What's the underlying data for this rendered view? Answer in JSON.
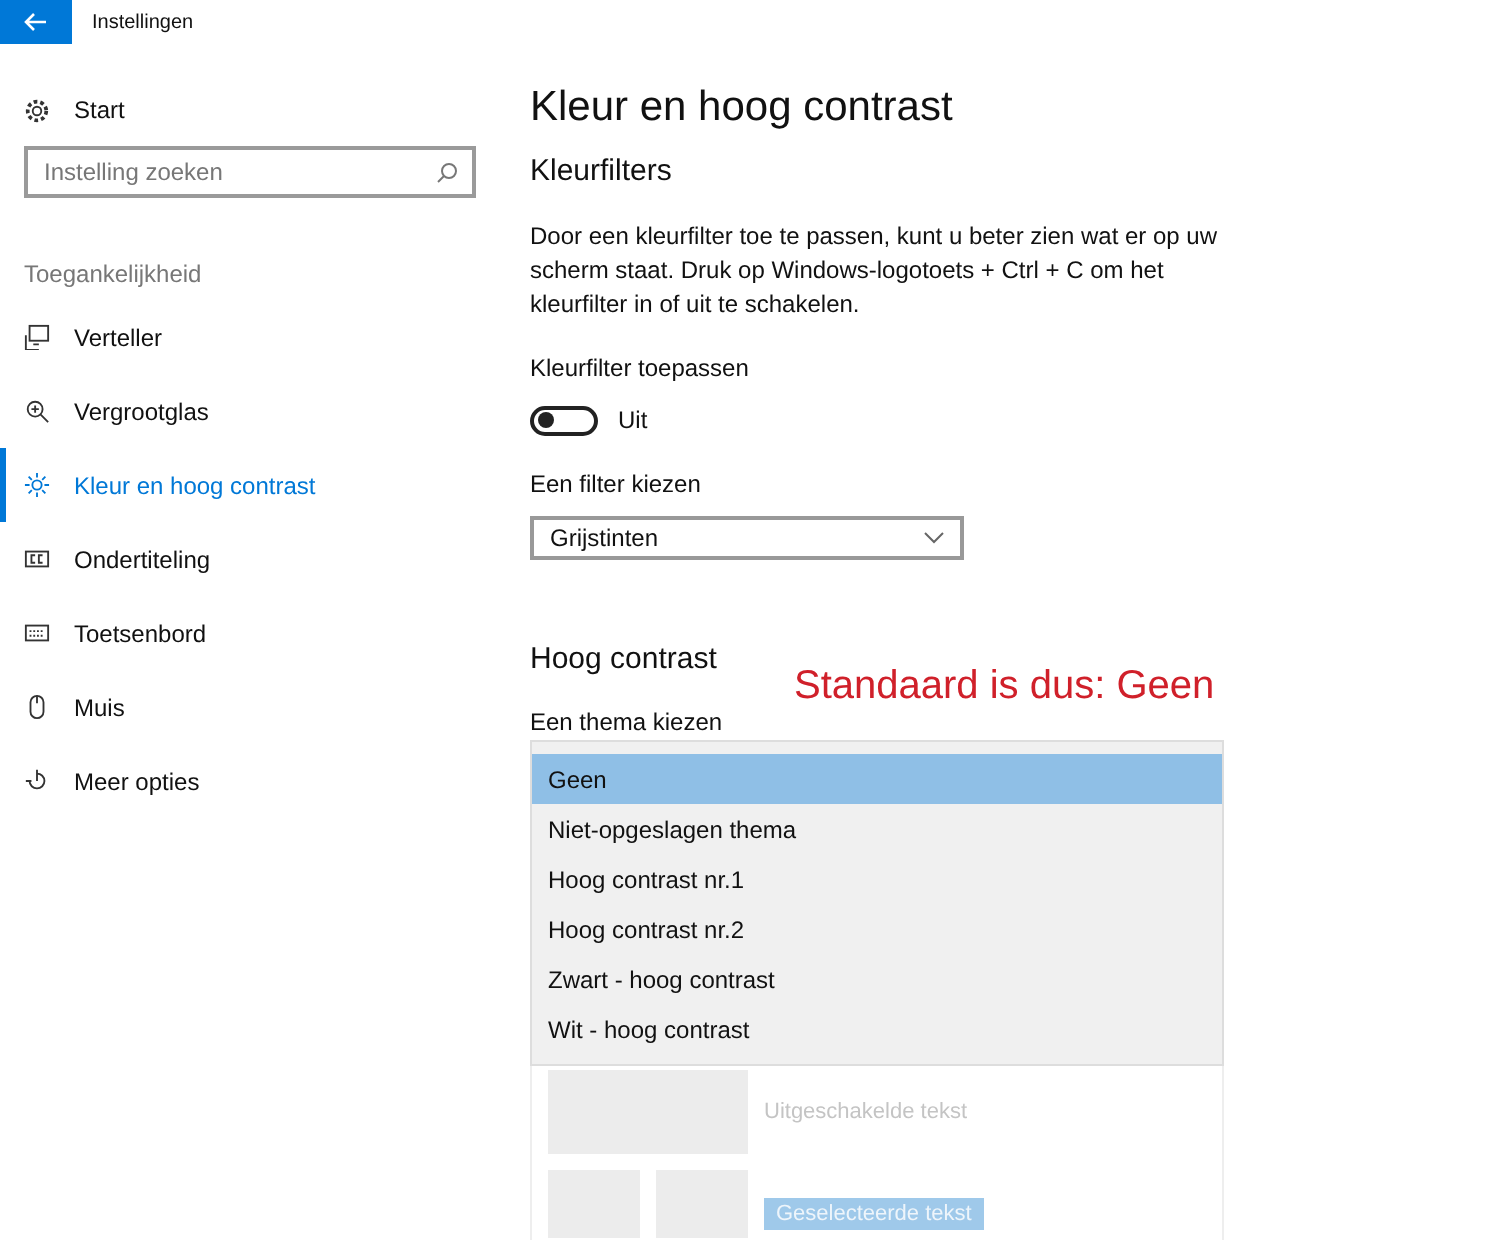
{
  "window": {
    "title": "Instellingen"
  },
  "sidebar": {
    "home": "Start",
    "search": {
      "placeholder": "Instelling zoeken"
    },
    "group": "Toegankelijkheid",
    "items": [
      {
        "label": "Verteller",
        "kind": "narrator",
        "selected": false
      },
      {
        "label": "Vergrootglas",
        "kind": "magnifier",
        "selected": false
      },
      {
        "label": "Kleur en hoog contrast",
        "kind": "color",
        "selected": true
      },
      {
        "label": "Ondertiteling",
        "kind": "captions",
        "selected": false
      },
      {
        "label": "Toetsenbord",
        "kind": "keyboard",
        "selected": false
      },
      {
        "label": "Muis",
        "kind": "mouse",
        "selected": false
      },
      {
        "label": "Meer opties",
        "kind": "more",
        "selected": false
      }
    ]
  },
  "main": {
    "title": "Kleur en hoog contrast",
    "color_filters": {
      "heading": "Kleurfilters",
      "description": "Door een kleurfilter toe te passen, kunt u beter zien wat er op uw scherm staat. Druk op Windows-logotoets + Ctrl + C om het kleurfilter in of uit te schakelen.",
      "toggle_label": "Kleurfilter toepassen",
      "toggle": {
        "on": false,
        "state": "Uit"
      },
      "filter_label": "Een filter kiezen",
      "filter_value": "Grijstinten"
    },
    "high_contrast": {
      "heading": "Hoog contrast",
      "annotation": "Standaard is dus:  Geen",
      "theme_label": "Een thema kiezen",
      "options": [
        {
          "label": "Geen",
          "selected": true
        },
        {
          "label": "Niet-opgeslagen thema",
          "selected": false
        },
        {
          "label": "Hoog contrast nr.1",
          "selected": false
        },
        {
          "label": "Hoog contrast nr.2",
          "selected": false
        },
        {
          "label": "Zwart - hoog contrast",
          "selected": false
        },
        {
          "label": "Wit - hoog contrast",
          "selected": false
        }
      ],
      "preview": {
        "disabled_text": "Uitgeschakelde tekst",
        "selected_text": "Geselecteerde tekst"
      }
    }
  }
}
